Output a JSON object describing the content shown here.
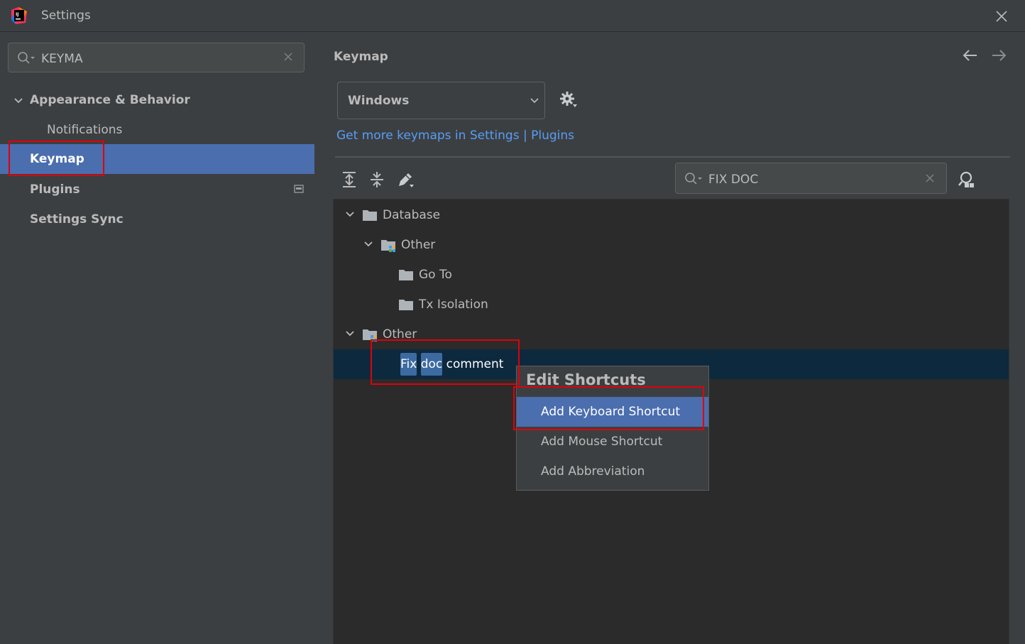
{
  "window": {
    "title": "Settings",
    "icons": {
      "logo": "intellij-logo-icon",
      "close": "close-icon"
    }
  },
  "sidebar": {
    "search": {
      "value": "KEYMA",
      "placeholder": ""
    },
    "items": [
      {
        "label": "Appearance & Behavior",
        "expanded": true,
        "bold": true
      },
      {
        "label": "Notifications"
      },
      {
        "label": "Keymap",
        "selected": true,
        "bold": true
      },
      {
        "label": "Plugins",
        "bold": true,
        "badge_icon": "plugin-status-icon"
      },
      {
        "label": "Settings Sync",
        "bold": true
      }
    ]
  },
  "main": {
    "title": "Keymap",
    "keymap_select": {
      "value": "Windows"
    },
    "more_link": "Get more keymaps in Settings | Plugins",
    "toolbar": {
      "expand_all_icon": "expand-all-icon",
      "collapse_all_icon": "collapse-all-icon",
      "edit_icon": "edit-icon",
      "find_by_shortcut_icon": "find-by-shortcut-icon"
    },
    "search": {
      "value": "FIX DOC"
    },
    "tree": [
      {
        "label": "Database",
        "level": 0,
        "expanded": true,
        "icon": "folder-icon"
      },
      {
        "label": "Other",
        "level": 1,
        "expanded": true,
        "icon": "folder-plugin-icon"
      },
      {
        "label": "Go To",
        "level": 2,
        "icon": "folder-icon"
      },
      {
        "label": "Tx Isolation",
        "level": 2,
        "icon": "folder-icon"
      },
      {
        "label": "Other",
        "level": 0,
        "expanded": true,
        "icon": "folder-plugin-icon"
      },
      {
        "label_parts": [
          "Fix",
          " ",
          "doc",
          " comment"
        ],
        "highlighted_parts": [
          0,
          2
        ],
        "level": 1,
        "selected": true
      }
    ]
  },
  "context_menu": {
    "title": "Edit Shortcuts",
    "items": [
      {
        "label": "Add Keyboard Shortcut",
        "active": true
      },
      {
        "label": "Add Mouse Shortcut"
      },
      {
        "label": "Add Abbreviation"
      }
    ]
  },
  "colors": {
    "background": "#3c3f41",
    "tree_background": "#2b2b2b",
    "selection": "#4b6eaf",
    "tree_selection": "#0d293e",
    "link": "#589df6",
    "annotation": "#e0000a"
  }
}
